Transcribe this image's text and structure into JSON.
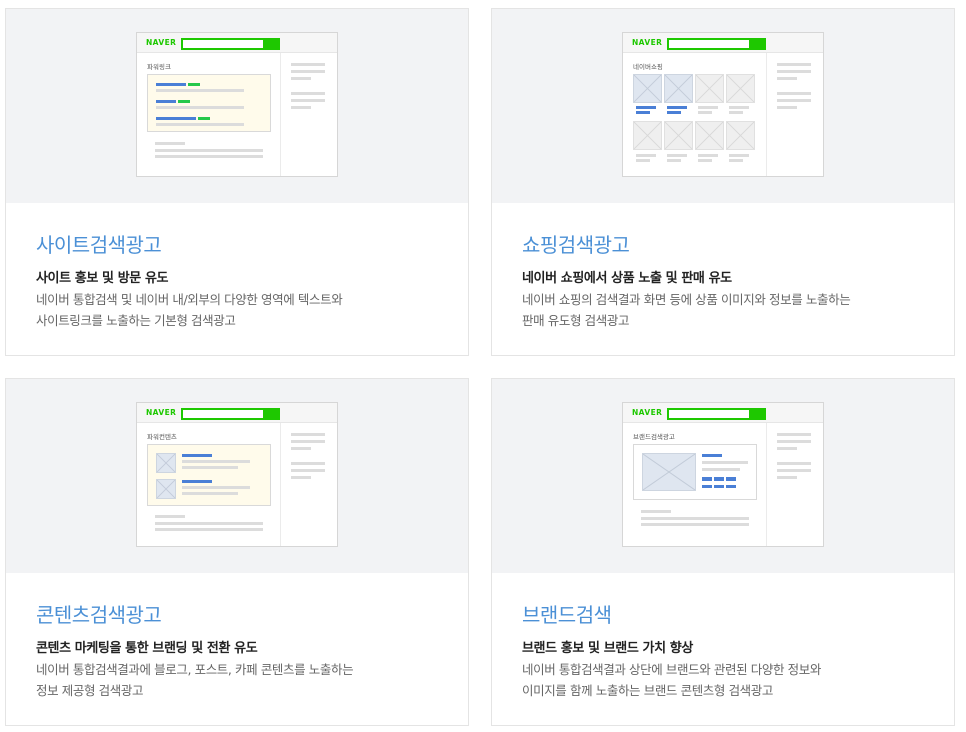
{
  "cards": [
    {
      "title": "사이트검색광고",
      "subtitle": "사이트 홍보 및 방문 유도",
      "desc_lines": [
        "네이버 통합검색 및 네이버 내/외부의 다양한 영역에 텍스트와",
        "사이트링크를 노출하는 기본형 검색광고"
      ],
      "mock": {
        "logo": "NAVER",
        "label": "파워링크"
      }
    },
    {
      "title": "쇼핑검색광고",
      "subtitle": "네이버 쇼핑에서 상품 노출 및 판매 유도",
      "desc_lines": [
        "네이버 쇼핑의 검색결과 화면 등에 상품 이미지와 정보를 노출하는",
        "판매 유도형 검색광고"
      ],
      "mock": {
        "logo": "NAVER",
        "label": "네이버쇼핑"
      }
    },
    {
      "title": "콘텐츠검색광고",
      "subtitle": "콘텐츠 마케팅을 통한 브랜딩 및 전환 유도",
      "desc_lines": [
        "네이버 통합검색결과에 블로그, 포스트, 카페 콘텐츠를 노출하는",
        "정보 제공형 검색광고"
      ],
      "mock": {
        "logo": "NAVER",
        "label": "파워컨텐츠"
      }
    },
    {
      "title": "브랜드검색",
      "subtitle": "브랜드 홍보 및 브랜드 가치 향상",
      "desc_lines": [
        "네이버 통합검색결과 상단에 브랜드와 관련된 다양한 정보와",
        "이미지를 함께 노출하는 브랜드 콘텐츠형 검색광고"
      ],
      "mock": {
        "logo": "NAVER",
        "label": "브랜드검색광고"
      }
    }
  ],
  "colors": {
    "title": "#4b90d6",
    "naver_green": "#1ec800",
    "accent_blue": "#4a7fd6",
    "preview_bg": "#f2f3f5"
  }
}
